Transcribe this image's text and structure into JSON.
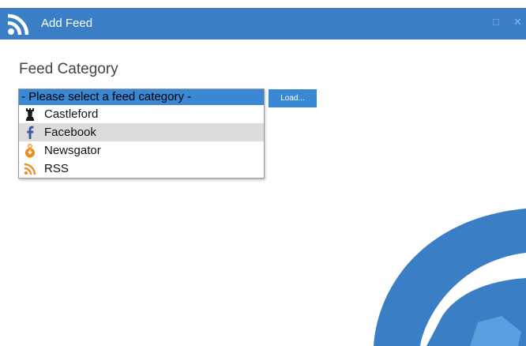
{
  "window": {
    "title": "Add Feed",
    "restore_glyph": "□",
    "close_glyph": "✕",
    "accent_color": "#3a7fc6"
  },
  "form": {
    "heading": "Feed Category",
    "load_button": "Load...",
    "dropdown": {
      "selected": "- Please select a feed category -",
      "options": [
        {
          "label": "Castleford",
          "icon": "castle-rook-icon"
        },
        {
          "label": "Facebook",
          "icon": "facebook-icon"
        },
        {
          "label": "Newsgator",
          "icon": "newsgator-icon"
        },
        {
          "label": "RSS",
          "icon": "rss-icon"
        }
      ],
      "hovered_index": 1
    }
  }
}
